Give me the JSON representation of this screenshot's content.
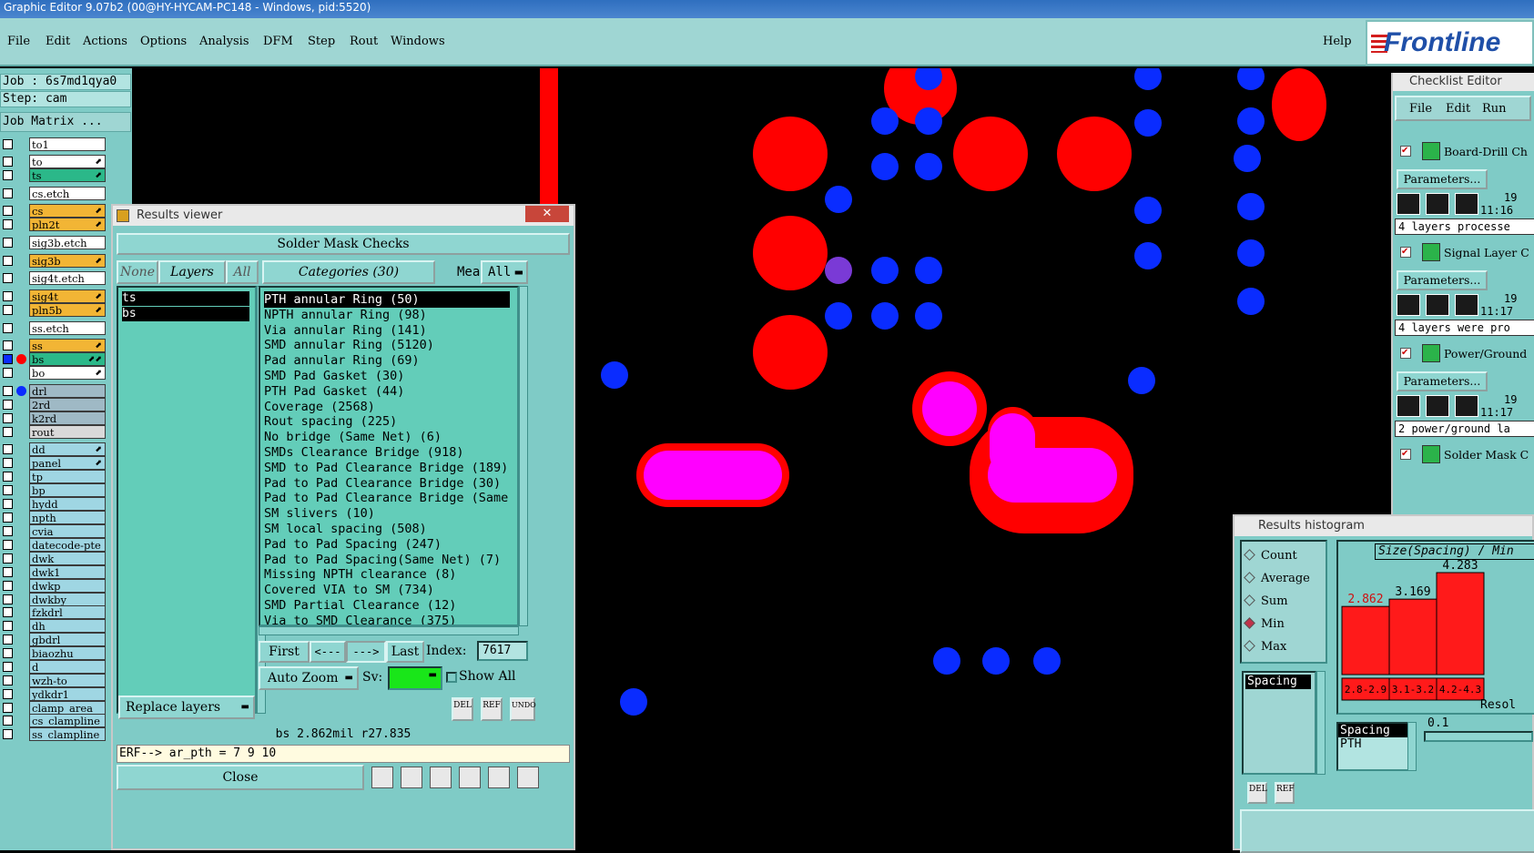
{
  "titlebar": {
    "text": "Graphic Editor 9.07b2 (00@HY-HYCAM-PC148 - Windows, pid:5520)"
  },
  "menu": {
    "items": [
      "File",
      "Edit",
      "Actions",
      "Options",
      "Analysis",
      "DFM",
      "Step",
      "Rout",
      "Windows"
    ],
    "help": "Help",
    "logo": "Frontline"
  },
  "left_panel": {
    "job": "Job  :  6s7md1qya0",
    "step": "Step:  cam",
    "job_matrix": "Job Matrix  ...",
    "layers": [
      {
        "name": "to1",
        "color": "#ffffff",
        "checked": false,
        "dot": "",
        "mark": ""
      },
      {
        "name": "to",
        "color": "#ffffff",
        "checked": false,
        "dot": "",
        "mark": "⬈"
      },
      {
        "name": "ts",
        "color": "#2bb889",
        "checked": false,
        "dot": "",
        "mark": "⬈"
      },
      {
        "name": "cs.etch",
        "color": "#ffffff",
        "checked": false,
        "dot": "",
        "mark": ""
      },
      {
        "name": "cs",
        "color": "#f2b535",
        "checked": false,
        "dot": "",
        "mark": "⬈"
      },
      {
        "name": "pln2t",
        "color": "#f2b535",
        "checked": false,
        "dot": "",
        "mark": "⬈"
      },
      {
        "name": "sig3b.etch",
        "color": "#ffffff",
        "checked": false,
        "dot": "",
        "mark": ""
      },
      {
        "name": "sig3b",
        "color": "#f2b535",
        "checked": false,
        "dot": "",
        "mark": "⬈"
      },
      {
        "name": "sig4t.etch",
        "color": "#ffffff",
        "checked": false,
        "dot": "",
        "mark": ""
      },
      {
        "name": "sig4t",
        "color": "#f2b535",
        "checked": false,
        "dot": "",
        "mark": "⬈"
      },
      {
        "name": "pln5b",
        "color": "#f2b535",
        "checked": false,
        "dot": "",
        "mark": "⬈"
      },
      {
        "name": "ss.etch",
        "color": "#ffffff",
        "checked": false,
        "dot": "",
        "mark": ""
      },
      {
        "name": "ss",
        "color": "#f2b535",
        "checked": false,
        "dot": "",
        "mark": "⬈"
      },
      {
        "name": "bs",
        "color": "#2bb889",
        "checked": true,
        "dot": "#ff0000",
        "mark": "⬈⬈"
      },
      {
        "name": "bo",
        "color": "#ffffff",
        "checked": false,
        "dot": "",
        "mark": "⬈"
      },
      {
        "name": "drl",
        "color": "#9fb9c5",
        "checked": false,
        "dot": "#0a2cff",
        "mark": ""
      },
      {
        "name": "2rd",
        "color": "#9fb9c5",
        "checked": false,
        "dot": "",
        "mark": ""
      },
      {
        "name": "k2rd",
        "color": "#9fb9c5",
        "checked": false,
        "dot": "",
        "mark": ""
      },
      {
        "name": "rout",
        "color": "#d9d9d9",
        "checked": false,
        "dot": "",
        "mark": ""
      },
      {
        "name": "dd",
        "color": "#9fd6e3",
        "checked": false,
        "dot": "",
        "mark": "⬈"
      },
      {
        "name": "panel",
        "color": "#9fd6e3",
        "checked": false,
        "dot": "",
        "mark": "⬈"
      },
      {
        "name": "tp",
        "color": "#9fd6e3",
        "checked": false,
        "dot": "",
        "mark": ""
      },
      {
        "name": "bp",
        "color": "#9fd6e3",
        "checked": false,
        "dot": "",
        "mark": ""
      },
      {
        "name": "hydd",
        "color": "#9fd6e3",
        "checked": false,
        "dot": "",
        "mark": ""
      },
      {
        "name": "npth",
        "color": "#9fd6e3",
        "checked": false,
        "dot": "",
        "mark": ""
      },
      {
        "name": "cvia",
        "color": "#9fd6e3",
        "checked": false,
        "dot": "",
        "mark": ""
      },
      {
        "name": "datecode-pte",
        "color": "#9fd6e3",
        "checked": false,
        "dot": "",
        "mark": ""
      },
      {
        "name": "dwk",
        "color": "#9fd6e3",
        "checked": false,
        "dot": "",
        "mark": ""
      },
      {
        "name": "dwk1",
        "color": "#9fd6e3",
        "checked": false,
        "dot": "",
        "mark": ""
      },
      {
        "name": "dwkp",
        "color": "#9fd6e3",
        "checked": false,
        "dot": "",
        "mark": ""
      },
      {
        "name": "dwkby",
        "color": "#9fd6e3",
        "checked": false,
        "dot": "",
        "mark": ""
      },
      {
        "name": "fzkdrl",
        "color": "#9fd6e3",
        "checked": false,
        "dot": "",
        "mark": ""
      },
      {
        "name": "dh",
        "color": "#9fd6e3",
        "checked": false,
        "dot": "",
        "mark": ""
      },
      {
        "name": "gbdrl",
        "color": "#9fd6e3",
        "checked": false,
        "dot": "",
        "mark": ""
      },
      {
        "name": "biaozhu",
        "color": "#9fd6e3",
        "checked": false,
        "dot": "",
        "mark": ""
      },
      {
        "name": "d",
        "color": "#9fd6e3",
        "checked": false,
        "dot": "",
        "mark": ""
      },
      {
        "name": "wzh-to",
        "color": "#9fd6e3",
        "checked": false,
        "dot": "",
        "mark": ""
      },
      {
        "name": "ydkdr1",
        "color": "#9fd6e3",
        "checked": false,
        "dot": "",
        "mark": ""
      },
      {
        "name": "clamp_area",
        "color": "#9fd6e3",
        "checked": false,
        "dot": "",
        "mark": ""
      },
      {
        "name": "cs_clampline",
        "color": "#9fd6e3",
        "checked": false,
        "dot": "",
        "mark": ""
      },
      {
        "name": "ss_clampline",
        "color": "#9fd6e3",
        "checked": false,
        "dot": "",
        "mark": ""
      }
    ]
  },
  "results_viewer": {
    "window_title": "Results viewer",
    "header": "Solder Mask Checks",
    "none_btn": "None",
    "layers_btn": "Layers",
    "all_btn": "All",
    "categories_btn": "Categories (30)",
    "meas_label": "Meas:",
    "meas_value": "All",
    "layer_items": [
      "ts",
      "bs"
    ],
    "categories": [
      "PTH annular Ring (50)",
      "NPTH annular Ring (98)",
      "Via annular Ring (141)",
      "SMD annular Ring (5120)",
      "Pad annular Ring (69)",
      "SMD Pad Gasket (30)",
      "PTH Pad Gasket (44)",
      "Coverage (2568)",
      "Rout spacing (225)",
      "No bridge (Same Net) (6)",
      "SMDs Clearance Bridge (918)",
      "SMD to Pad Clearance Bridge (189)",
      "Pad to Pad Clearance Bridge (30)",
      "Pad to Pad Clearance Bridge (Same",
      "SM slivers (10)",
      "SM local spacing (508)",
      "Pad to Pad Spacing (247)",
      "Pad to Pad Spacing(Same Net) (7)",
      "Missing NPTH clearance (8)",
      "Covered VIA to SM (734)",
      "SMD Partial Clearance (12)",
      "Via to SMD Clearance (375)"
    ],
    "first_btn": "First",
    "prev_btn": "<---",
    "next_btn": "--->",
    "last_btn": "Last",
    "index_label": "Index:",
    "index_value": "7617",
    "autozoom_btn": "Auto Zoom",
    "sv_label": "Sv:",
    "show_all_label": "Show All",
    "replace_btn": "Replace layers",
    "del_label": "DEL",
    "ref_label": "REF",
    "undo_label": "UNDO",
    "status_line": "bs 2.862mil   r27.835",
    "erf_line": "ERF--> ar_pth = 7 9 10",
    "close_btn": "Close"
  },
  "checklist_editor": {
    "window_title": "Checklist Editor",
    "menu": [
      "File",
      "Edit",
      "Run"
    ],
    "checks": [
      {
        "name": "Board-Drill Ch",
        "time": "11:16",
        "status": "4 layers processe"
      },
      {
        "name": "Signal Layer C",
        "time": "11:17",
        "status": "4 layers were pro"
      },
      {
        "name": "Power/Ground",
        "time": "11:17",
        "status": "2 power/ground la"
      },
      {
        "name": "Solder Mask C",
        "time": "",
        "status": ""
      }
    ],
    "params_btn": "Parameters...",
    "num_label": "19"
  },
  "histogram": {
    "window_title": "Results histogram",
    "options": [
      "Count",
      "Average",
      "Sum",
      "Min",
      "Max"
    ],
    "selected_option": "Min",
    "chart_title": "Size(Spacing) / Min",
    "list_items": [
      "Spacing"
    ],
    "spacing_label": "Spacing",
    "pth_label": "PTH",
    "resol_label": "Resol",
    "resol_value": "0.1",
    "del_label": "DEL",
    "ref_label": "REF"
  },
  "chart_data": {
    "type": "bar",
    "title": "Size(Spacing) / Min",
    "categories": [
      "2.8-2.9",
      "3.1-3.2",
      "4.2-4.3"
    ],
    "values": [
      2.862,
      3.169,
      4.283
    ],
    "value_labels": [
      "2.862",
      "3.169",
      "4.283"
    ],
    "ylim": [
      0,
      4.283
    ]
  }
}
